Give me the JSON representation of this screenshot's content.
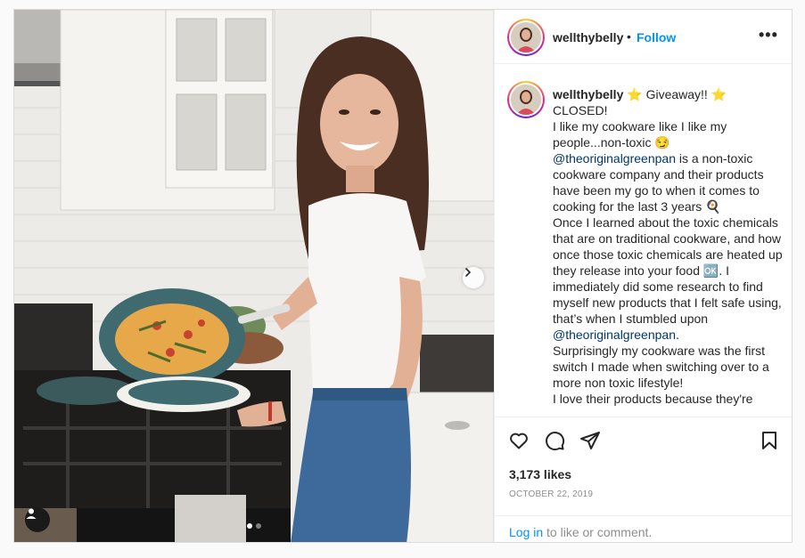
{
  "post": {
    "username": "wellthybelly",
    "follow_label": "Follow",
    "separator": "•",
    "more_label": "•••"
  },
  "caption": {
    "username": "wellthybelly",
    "lines": [
      "Giveaway!!",
      "CLOSED!",
      "I like my cookware like I like my people...non-toxic",
      "is a non-toxic cookware company and their products have been my go to when it comes to cooking for the last 3 years",
      "Once I learned about the toxic chemicals that are on traditional cookware, and how once those toxic chemicals are heated up they release into your food",
      ". I immediately did some research to find myself new products that I felt safe using, that’s when I stumbled upon",
      "Surprisingly my cookware was the first switch I made when switching over to a more non toxic lifestyle!",
      "I love their products because they're"
    ],
    "mention": "@theoriginalgreenpan"
  },
  "stats": {
    "likes": "3,173 likes",
    "date": "OCTOBER 22, 2019"
  },
  "login": {
    "link": "Log in",
    "rest": " to like or comment."
  },
  "icons": {
    "like": "heart-icon",
    "comment": "comment-icon",
    "share": "share-icon",
    "save": "bookmark-icon",
    "next": "chevron-right-icon",
    "tag": "user-tag-icon"
  },
  "colors": {
    "accent": "#0095f6",
    "mention": "#00376b",
    "muted": "#8e8e8e"
  },
  "carousel": {
    "current": 1,
    "total": 2
  }
}
